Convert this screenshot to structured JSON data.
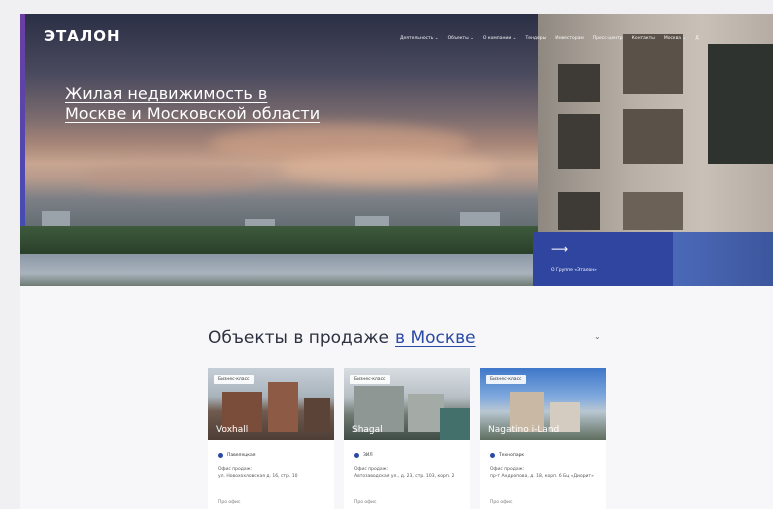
{
  "brand": {
    "logo": "ЭТАЛОН"
  },
  "nav": [
    {
      "label": "Деятельность ⌄"
    },
    {
      "label": "Объекты ⌄"
    },
    {
      "label": "О компании ⌄"
    },
    {
      "label": "Тендеры"
    },
    {
      "label": "Инвесторам"
    },
    {
      "label": "Пресс-центр"
    },
    {
      "label": "Контакты"
    },
    {
      "label": "Москва ⌄"
    },
    {
      "label": "Д"
    }
  ],
  "hero": {
    "headline": "Жилая недвижимость в Москве и Московской области",
    "about_arrow": "⟶",
    "about_label": "О Группе «Эталон»"
  },
  "sale": {
    "title": "Объекты в продаже",
    "city_link": "в Москве",
    "chevron": "⌄"
  },
  "cards": [
    {
      "badge": "Бизнес-класс",
      "name": "Voxhall",
      "metro": "Павелецкая",
      "address_label": "Офис продаж:",
      "address": "ул. Новохохловская д. 16, стр. 10",
      "more": "Про офис"
    },
    {
      "badge": "Бизнес-класс",
      "name": "Shagal",
      "metro": "ЗИЛ",
      "address_label": "Офис продаж:",
      "address": "Автозаводская ул., д. 23, стр. 103, корп. 2",
      "more": "Про офис"
    },
    {
      "badge": "Бизнес-класс",
      "name": "Nagatino i-Land",
      "metro": "Технопарк",
      "address_label": "Офис продаж:",
      "address": "пр-т Андропова, д. 18, корп. 6 Бц «Диорит»",
      "more": "Про офис"
    }
  ],
  "colors": {
    "accent": "#2a49a6",
    "about_panel": "#2f45a0"
  }
}
